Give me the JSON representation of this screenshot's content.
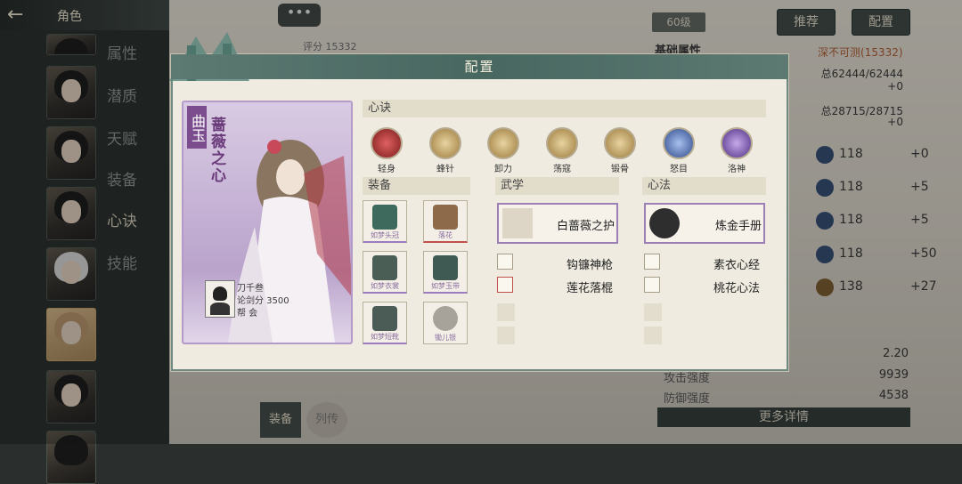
{
  "topbar": {
    "title": "角色",
    "back_icon": "back-arrow-icon"
  },
  "rail_tabs": [
    "属性",
    "潜质",
    "天赋",
    "装备",
    "心诀",
    "技能"
  ],
  "background": {
    "chat_label": "•••",
    "score_tag": "评分 15332",
    "level_badge": "60级",
    "recommend_btn": "推荐",
    "config_btn": "配置",
    "stats_heading": "基础属性",
    "stats_power": "深不可测(15332)",
    "stat_lines": [
      "总62444/62444",
      "+0",
      "总28715/28715",
      "+0"
    ],
    "skill_rows": [
      {
        "num": "118",
        "plus": "+0"
      },
      {
        "num": "118",
        "plus": "+5"
      },
      {
        "num": "118",
        "plus": "+5"
      },
      {
        "num": "118",
        "plus": "+50"
      },
      {
        "num": "138",
        "plus": "+27"
      }
    ],
    "bottom_stats": [
      {
        "label": "",
        "value": "2.20"
      },
      {
        "label": "攻击强度",
        "value": "9939"
      },
      {
        "label": "防御强度",
        "value": "4538"
      }
    ],
    "more_btn": "更多详情",
    "bottom_tab_equip": "装备",
    "bottom_tab_bio": "列传"
  },
  "modal": {
    "title": "配置",
    "character": {
      "name": "曲玉",
      "title": "蔷薇之心",
      "owner_name": "刀千叁",
      "owner_score": "论剑分 3500",
      "owner_guild": "帮  会"
    },
    "xinjue_label": "心诀",
    "xinjue": [
      {
        "name": "轻身",
        "color": "#b23b3b"
      },
      {
        "name": "蜂针",
        "color": "#b08a3c"
      },
      {
        "name": "卸力",
        "color": "#b08a3c"
      },
      {
        "name": "荡寇",
        "color": "#b08a3c"
      },
      {
        "name": "锻骨",
        "color": "#b08a3c"
      },
      {
        "name": "怒目",
        "color": "#3f5ea8"
      },
      {
        "name": "洛神",
        "color": "#6b4aa0"
      }
    ],
    "equip_label": "装备",
    "equips": [
      {
        "name": "如梦头冠",
        "rim": "purple",
        "color": "#3d6a5c"
      },
      {
        "name": "落花",
        "rim": "red",
        "color": "#8c6a4a"
      },
      {
        "name": "如梦衣裳",
        "rim": "purple",
        "color": "#4a5e56"
      },
      {
        "name": "如梦玉带",
        "rim": "purple",
        "color": "#3f5a52"
      },
      {
        "name": "如梦短靴",
        "rim": "purple",
        "color": "#4b5c57"
      },
      {
        "name": "锄儿银",
        "rim": "none",
        "color": "#a7a39a"
      }
    ],
    "wuxue_label": "武学",
    "wuxue_main": "白蔷薇之护",
    "wuxue_subs": [
      "钩镰神枪",
      "莲花落棍"
    ],
    "xinfa_label": "心法",
    "xinfa_main": "炼金手册",
    "xinfa_subs": [
      "素衣心经",
      "桃花心法"
    ]
  }
}
